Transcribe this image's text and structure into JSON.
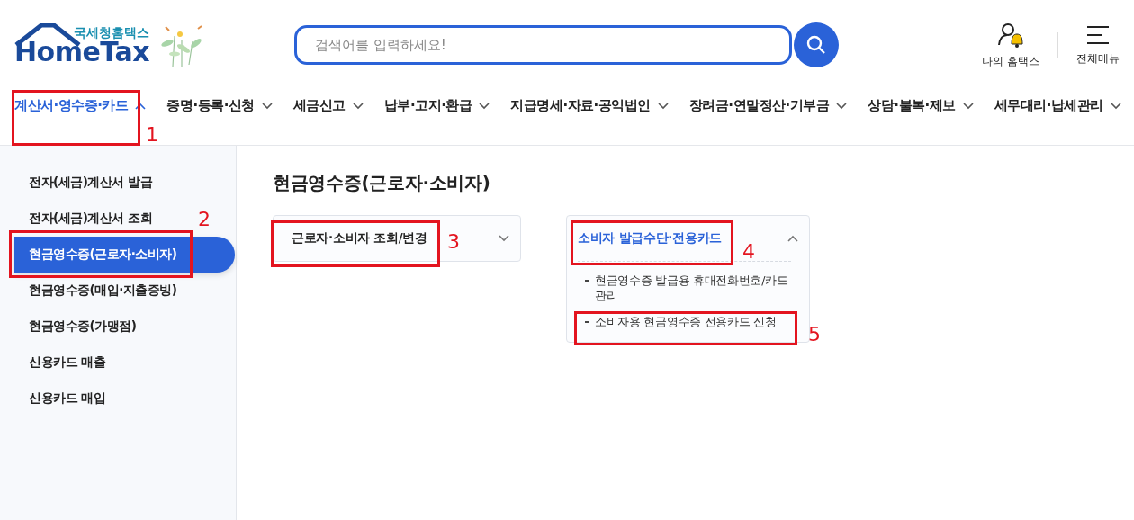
{
  "logo": {
    "tagline": "국세청홈택스",
    "name": "HomeTax"
  },
  "search": {
    "placeholder": "검색어를 입력하세요!"
  },
  "utility": [
    {
      "kind": "user",
      "label": "나의 홈택스"
    },
    {
      "kind": "menu",
      "label": "전체메뉴"
    }
  ],
  "nav": [
    {
      "label": "계산서·영수증·카드",
      "selected": true
    },
    {
      "label": "증명·등록·신청",
      "selected": false
    },
    {
      "label": "세금신고",
      "selected": false
    },
    {
      "label": "납부·고지·환급",
      "selected": false
    },
    {
      "label": "지급명세·자료·공익법인",
      "selected": false
    },
    {
      "label": "장려금·연말정산·기부금",
      "selected": false
    },
    {
      "label": "상담·불복·제보",
      "selected": false
    },
    {
      "label": "세무대리·납세관리",
      "selected": false
    }
  ],
  "sidebar": {
    "items": [
      {
        "label": "전자(세금)계산서 발급",
        "selected": false
      },
      {
        "label": "전자(세금)계산서 조회",
        "selected": false
      },
      {
        "label": "현금영수증(근로자·소비자)",
        "selected": true
      },
      {
        "label": "현금영수증(매입·지출증빙)",
        "selected": false
      },
      {
        "label": "현금영수증(가맹점)",
        "selected": false
      },
      {
        "label": "신용카드 매출",
        "selected": false
      },
      {
        "label": "신용카드 매입",
        "selected": false
      }
    ]
  },
  "page_title": "현금영수증(근로자·소비자)",
  "accordions": [
    {
      "title": "근로자·소비자 조회/변경",
      "expanded": false
    },
    {
      "title": "소비자 발급수단·전용카드",
      "expanded": true,
      "items": [
        "현금영수증 발급용 휴대전화번호/카드관리",
        "소비자용 현금영수증 전용카드 신청"
      ]
    }
  ],
  "annotations": [
    {
      "label": "1"
    },
    {
      "label": "2"
    },
    {
      "label": "3"
    },
    {
      "label": "4"
    },
    {
      "label": "5"
    }
  ]
}
